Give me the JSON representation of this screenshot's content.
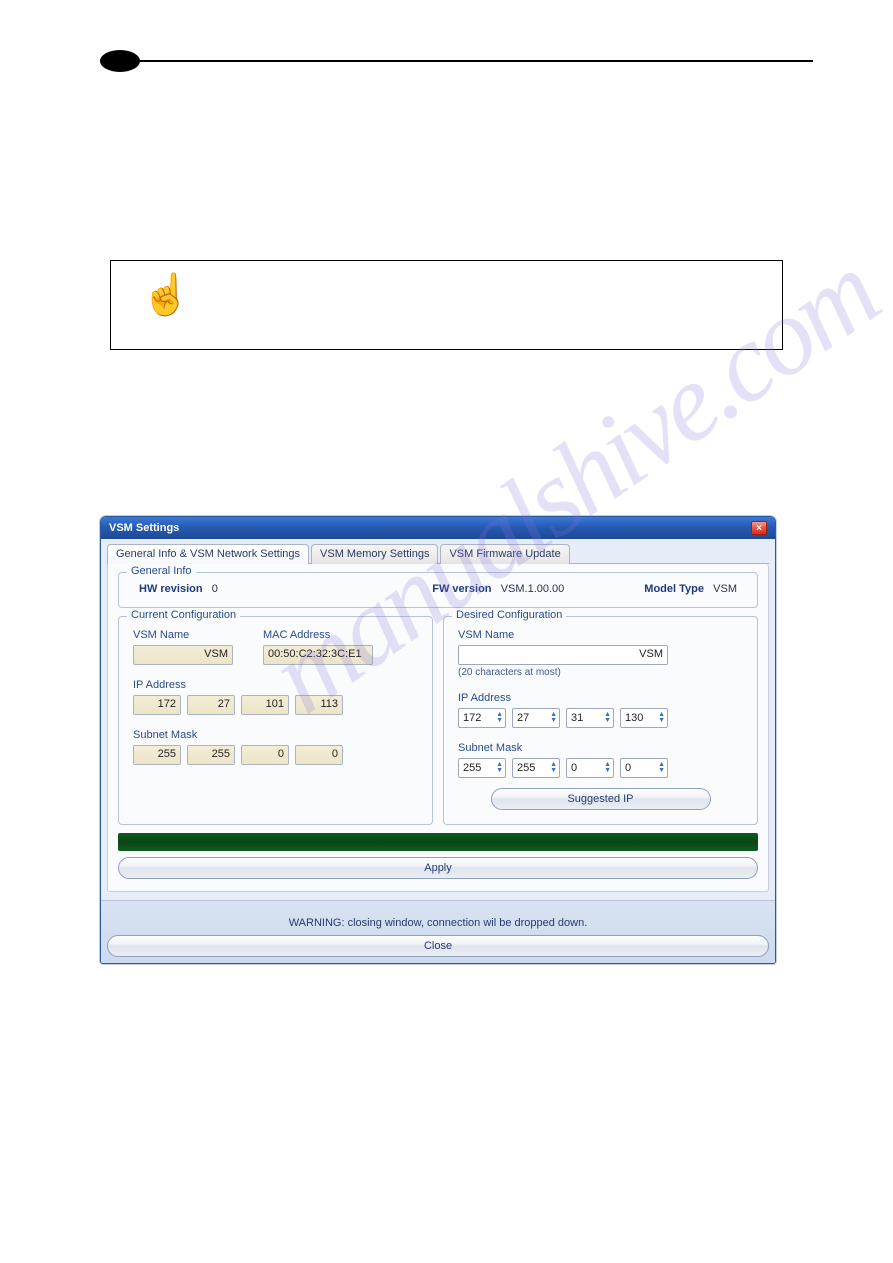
{
  "watermark": "manualshive.com",
  "window": {
    "title": "VSM Settings",
    "tabs": [
      "General Info & VSM Network Settings",
      "VSM Memory Settings",
      "VSM Firmware Update"
    ],
    "general": {
      "group_title": "General Info",
      "hw_label": "HW revision",
      "hw_value": "0",
      "fw_label": "FW version",
      "fw_value": "VSM.1.00.00",
      "model_label": "Model Type",
      "model_value": "VSM"
    },
    "current": {
      "group_title": "Current Configuration",
      "name_label": "VSM Name",
      "name_value": "VSM",
      "mac_label": "MAC Address",
      "mac_value": "00:50:C2:32:3C:E1",
      "ip_label": "IP Address",
      "ip": [
        "172",
        "27",
        "101",
        "113"
      ],
      "mask_label": "Subnet Mask",
      "mask": [
        "255",
        "255",
        "0",
        "0"
      ]
    },
    "desired": {
      "group_title": "Desired Configuration",
      "name_label": "VSM Name",
      "name_value": "VSM",
      "hint": "(20 characters at most)",
      "ip_label": "IP Address",
      "ip": [
        "172",
        "27",
        "31",
        "130"
      ],
      "mask_label": "Subnet Mask",
      "mask": [
        "255",
        "255",
        "0",
        "0"
      ],
      "suggest_btn": "Suggested IP"
    },
    "apply_btn": "Apply",
    "warning": "WARNING: closing window, connection wil be dropped down.",
    "close_btn": "Close"
  }
}
